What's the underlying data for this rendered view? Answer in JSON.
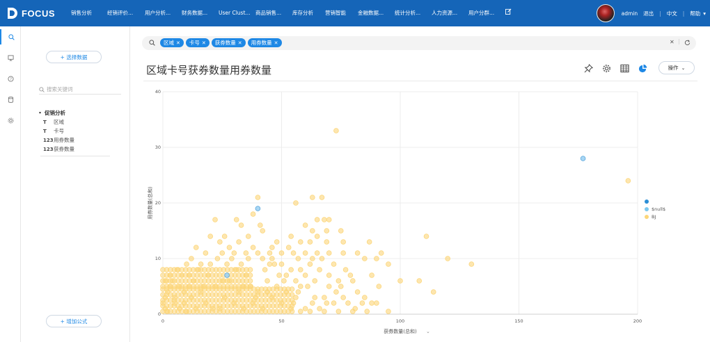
{
  "app": {
    "brand": "FOCUS"
  },
  "nav": [
    "销售分析",
    "经销评价...",
    "用户分析...",
    "财务数据...",
    "User Clust...",
    "商品销售...",
    "库存分析",
    "营销智能",
    "金融数据...",
    "统计分析...",
    "人力资源...",
    "用户分群..."
  ],
  "user": {
    "name": "admin",
    "logout": "退出",
    "lang": "中文",
    "help": "帮助"
  },
  "sidebar": {
    "select_data": "+ 选择数据",
    "search_placeholder": "搜索关键词",
    "group": "促销分析",
    "fields": [
      {
        "type": "T",
        "name": "区域"
      },
      {
        "type": "T",
        "name": "卡号"
      },
      {
        "type": "123",
        "name": "用券数量"
      },
      {
        "type": "123",
        "name": "获券数量"
      }
    ],
    "add_formula": "+ 增加公式"
  },
  "filter_tags": [
    "区域",
    "卡号",
    "获券数量",
    "用券数量"
  ],
  "page_title": "区域卡号获券数量用券数量",
  "toolbar": {
    "operate": "操作"
  },
  "chart_data": {
    "type": "scatter",
    "xlabel": "获券数量(总和)",
    "ylabel": "用券数量(总和)",
    "xlim": [
      0,
      200
    ],
    "ylim": [
      0,
      40
    ],
    "xticks": [
      0,
      50,
      100,
      150,
      200
    ],
    "yticks": [
      0,
      10,
      20,
      30,
      40
    ],
    "legend": [
      "",
      "$null$",
      "BJ"
    ],
    "colors": {
      "blank": "#2b8ed6",
      "null": "#7cc8ef",
      "BJ": "#fcd67a"
    },
    "series": [
      {
        "name": "",
        "points": [
          [
            177,
            28
          ],
          [
            40,
            19
          ],
          [
            27,
            7
          ]
        ]
      },
      {
        "name": "$null$",
        "points": []
      },
      {
        "name": "BJ",
        "points": [
          [
            73,
            33
          ],
          [
            196,
            24
          ],
          [
            40,
            21
          ],
          [
            56,
            20
          ],
          [
            63,
            21
          ],
          [
            67,
            21
          ],
          [
            38,
            18
          ],
          [
            22,
            17
          ],
          [
            31,
            17
          ],
          [
            41,
            16
          ],
          [
            42,
            15
          ],
          [
            33,
            16
          ],
          [
            65,
            17
          ],
          [
            68,
            17
          ],
          [
            70,
            17
          ],
          [
            60,
            16
          ],
          [
            63,
            15
          ],
          [
            65,
            14
          ],
          [
            69,
            15
          ],
          [
            75,
            15
          ],
          [
            111,
            14
          ],
          [
            54,
            14
          ],
          [
            58,
            13
          ],
          [
            62,
            13
          ],
          [
            48,
            13
          ],
          [
            69,
            13
          ],
          [
            76,
            13
          ],
          [
            87,
            13
          ],
          [
            76,
            11
          ],
          [
            82,
            11
          ],
          [
            92,
            11
          ],
          [
            25,
            11
          ],
          [
            30,
            11
          ],
          [
            35,
            11
          ],
          [
            40,
            11
          ],
          [
            45,
            11
          ],
          [
            50,
            11
          ],
          [
            55,
            11
          ],
          [
            60,
            11
          ],
          [
            65,
            11
          ],
          [
            70,
            11
          ],
          [
            120,
            10
          ],
          [
            130,
            9
          ],
          [
            85,
            10
          ],
          [
            90,
            10
          ],
          [
            95,
            9
          ],
          [
            100,
            6
          ],
          [
            108,
            6
          ],
          [
            114,
            4
          ],
          [
            88,
            7
          ],
          [
            80,
            6
          ],
          [
            75,
            5
          ],
          [
            70,
            5
          ],
          [
            78,
            2
          ],
          [
            85,
            3
          ],
          [
            90,
            2
          ],
          [
            88,
            2
          ],
          [
            82,
            4
          ],
          [
            64,
            3
          ],
          [
            58,
            5
          ],
          [
            55,
            2
          ],
          [
            60,
            1
          ],
          [
            66,
            1
          ],
          [
            72,
            2
          ],
          [
            79,
            7
          ],
          [
            84,
            2
          ],
          [
            47,
            9
          ],
          [
            52,
            7
          ],
          [
            44,
            6
          ],
          [
            38,
            12
          ],
          [
            32,
            13
          ],
          [
            28,
            12
          ],
          [
            24,
            13
          ],
          [
            18,
            11
          ],
          [
            14,
            12
          ],
          [
            12,
            10
          ],
          [
            10,
            9
          ],
          [
            15,
            8
          ],
          [
            20,
            9
          ],
          [
            6,
            8
          ],
          [
            8,
            7
          ],
          [
            4,
            6
          ],
          [
            3,
            5
          ],
          [
            2,
            4
          ],
          [
            1,
            3
          ],
          [
            0,
            2
          ],
          [
            1,
            1
          ],
          [
            2,
            0.5
          ],
          [
            5,
            2
          ],
          [
            9,
            2
          ],
          [
            12,
            3
          ],
          [
            16,
            4
          ],
          [
            22,
            5
          ],
          [
            28,
            6
          ],
          [
            34,
            5
          ],
          [
            40,
            4
          ],
          [
            46,
            3
          ],
          [
            50,
            2
          ],
          [
            54,
            1
          ],
          [
            58,
            0.5
          ],
          [
            62,
            0.5
          ],
          [
            68,
            0.5
          ],
          [
            74,
            0.5
          ],
          [
            80,
            0.5
          ],
          [
            35,
            7
          ],
          [
            31,
            8
          ],
          [
            27,
            9
          ],
          [
            23,
            10
          ],
          [
            19,
            7
          ],
          [
            13,
            6
          ],
          [
            7,
            5
          ],
          [
            43,
            8
          ],
          [
            48,
            5
          ],
          [
            52,
            4
          ],
          [
            56,
            3
          ],
          [
            61,
            5
          ],
          [
            42,
            10
          ],
          [
            45,
            9
          ],
          [
            50,
            9
          ],
          [
            54,
            8
          ],
          [
            58,
            8
          ],
          [
            62,
            9
          ],
          [
            66,
            8
          ],
          [
            70,
            7
          ],
          [
            74,
            6
          ],
          [
            26,
            3
          ],
          [
            30,
            2
          ],
          [
            34,
            1
          ],
          [
            38,
            2
          ],
          [
            42,
            1
          ],
          [
            18,
            2
          ],
          [
            21,
            1
          ],
          [
            24,
            1
          ],
          [
            9,
            4
          ],
          [
            11,
            5
          ],
          [
            17,
            5
          ],
          [
            36,
            10
          ],
          [
            33,
            9
          ],
          [
            29,
            10
          ],
          [
            46,
            12
          ],
          [
            53,
            12
          ],
          [
            57,
            10
          ],
          [
            63,
            10
          ],
          [
            67,
            10
          ],
          [
            72,
            9
          ],
          [
            77,
            8
          ],
          [
            73,
            4
          ],
          [
            68,
            3
          ],
          [
            64,
            6
          ],
          [
            60,
            7
          ],
          [
            56,
            6
          ],
          [
            49,
            7
          ],
          [
            44,
            4
          ],
          [
            39,
            3
          ],
          [
            37,
            5
          ],
          [
            32,
            4
          ],
          [
            25,
            6
          ],
          [
            16,
            9
          ],
          [
            11,
            7
          ],
          [
            5,
            3
          ],
          [
            7,
            1
          ],
          [
            10,
            0.5
          ],
          [
            14,
            1
          ],
          [
            3,
            7
          ],
          [
            1,
            6
          ],
          [
            20,
            14
          ],
          [
            26,
            14
          ],
          [
            36,
            14
          ],
          [
            46,
            10
          ],
          [
            51,
            6
          ],
          [
            57,
            4
          ],
          [
            63,
            2
          ],
          [
            69,
            2
          ],
          [
            76,
            3
          ],
          [
            81,
            1
          ],
          [
            86,
            0.5
          ],
          [
            91,
            5
          ],
          [
            95,
            0.5
          ]
        ]
      }
    ]
  }
}
